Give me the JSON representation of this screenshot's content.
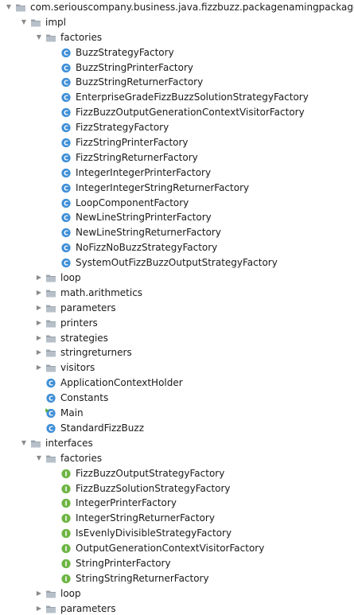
{
  "tree": {
    "items": [
      {
        "label": "com.seriouscompany.business.java.fizzbuzz.packagenamingpackage",
        "kind": "package",
        "depth": 0,
        "expanded": true
      },
      {
        "label": "impl",
        "kind": "package",
        "depth": 1,
        "expanded": true
      },
      {
        "label": "factories",
        "kind": "package",
        "depth": 2,
        "expanded": true
      },
      {
        "label": "BuzzStrategyFactory",
        "kind": "class",
        "depth": 3
      },
      {
        "label": "BuzzStringPrinterFactory",
        "kind": "class",
        "depth": 3
      },
      {
        "label": "BuzzStringReturnerFactory",
        "kind": "class",
        "depth": 3
      },
      {
        "label": "EnterpriseGradeFizzBuzzSolutionStrategyFactory",
        "kind": "class",
        "depth": 3
      },
      {
        "label": "FizzBuzzOutputGenerationContextVisitorFactory",
        "kind": "class",
        "depth": 3
      },
      {
        "label": "FizzStrategyFactory",
        "kind": "class",
        "depth": 3
      },
      {
        "label": "FizzStringPrinterFactory",
        "kind": "class",
        "depth": 3
      },
      {
        "label": "FizzStringReturnerFactory",
        "kind": "class",
        "depth": 3
      },
      {
        "label": "IntegerIntegerPrinterFactory",
        "kind": "class",
        "depth": 3
      },
      {
        "label": "IntegerIntegerStringReturnerFactory",
        "kind": "class",
        "depth": 3
      },
      {
        "label": "LoopComponentFactory",
        "kind": "class",
        "depth": 3
      },
      {
        "label": "NewLineStringPrinterFactory",
        "kind": "class",
        "depth": 3
      },
      {
        "label": "NewLineStringReturnerFactory",
        "kind": "class",
        "depth": 3
      },
      {
        "label": "NoFizzNoBuzzStrategyFactory",
        "kind": "class",
        "depth": 3
      },
      {
        "label": "SystemOutFizzBuzzOutputStrategyFactory",
        "kind": "class",
        "depth": 3
      },
      {
        "label": "loop",
        "kind": "package",
        "depth": 2,
        "expanded": false
      },
      {
        "label": "math.arithmetics",
        "kind": "package",
        "depth": 2,
        "expanded": false
      },
      {
        "label": "parameters",
        "kind": "package",
        "depth": 2,
        "expanded": false
      },
      {
        "label": "printers",
        "kind": "package",
        "depth": 2,
        "expanded": false
      },
      {
        "label": "strategies",
        "kind": "package",
        "depth": 2,
        "expanded": false
      },
      {
        "label": "stringreturners",
        "kind": "package",
        "depth": 2,
        "expanded": false
      },
      {
        "label": "visitors",
        "kind": "package",
        "depth": 2,
        "expanded": false
      },
      {
        "label": "ApplicationContextHolder",
        "kind": "class",
        "depth": 2
      },
      {
        "label": "Constants",
        "kind": "class",
        "depth": 2
      },
      {
        "label": "Main",
        "kind": "main-class",
        "depth": 2
      },
      {
        "label": "StandardFizzBuzz",
        "kind": "class",
        "depth": 2
      },
      {
        "label": "interfaces",
        "kind": "package",
        "depth": 1,
        "expanded": true
      },
      {
        "label": "factories",
        "kind": "package",
        "depth": 2,
        "expanded": true
      },
      {
        "label": "FizzBuzzOutputStrategyFactory",
        "kind": "interface",
        "depth": 3
      },
      {
        "label": "FizzBuzzSolutionStrategyFactory",
        "kind": "interface",
        "depth": 3
      },
      {
        "label": "IntegerPrinterFactory",
        "kind": "interface",
        "depth": 3
      },
      {
        "label": "IntegerStringReturnerFactory",
        "kind": "interface",
        "depth": 3
      },
      {
        "label": "IsEvenlyDivisibleStrategyFactory",
        "kind": "interface",
        "depth": 3
      },
      {
        "label": "OutputGenerationContextVisitorFactory",
        "kind": "interface",
        "depth": 3
      },
      {
        "label": "StringPrinterFactory",
        "kind": "interface",
        "depth": 3
      },
      {
        "label": "StringStringReturnerFactory",
        "kind": "interface",
        "depth": 3
      },
      {
        "label": "loop",
        "kind": "package",
        "depth": 2,
        "expanded": false
      },
      {
        "label": "parameters",
        "kind": "package",
        "depth": 2,
        "expanded": false
      }
    ]
  },
  "icons": {
    "package": "folder-icon",
    "class": "class-icon",
    "main-class": "main-class-icon",
    "interface": "interface-icon",
    "expanded": "chevron-down-icon",
    "collapsed": "chevron-right-icon"
  },
  "colors": {
    "class_badge": "#3f8fd6",
    "interface_badge": "#6eb544",
    "main_run_marker": "#5cae3a",
    "folder": "#9aa4ae",
    "arrow": "#8a8a8a",
    "text": "#1a1a1a"
  }
}
